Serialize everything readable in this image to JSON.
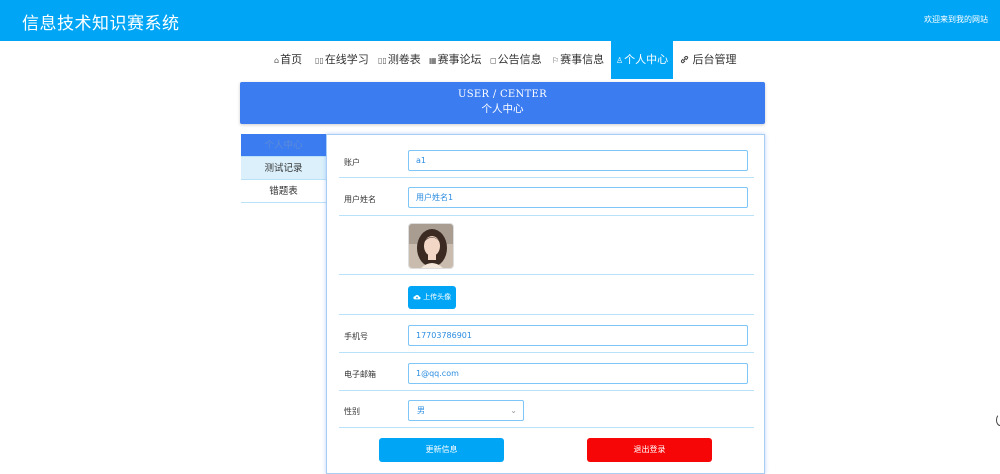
{
  "header": {
    "title": "信息技术知识赛系统",
    "welcome": "欢迎来到我的网站"
  },
  "nav": {
    "items": [
      {
        "icon": "⌂",
        "icon_name": "home-icon",
        "label": "首页"
      },
      {
        "icon": "▯▯",
        "icon_name": "book-icon",
        "label": "在线学习"
      },
      {
        "icon": "▯▯",
        "icon_name": "test-icon",
        "label": "测卷表"
      },
      {
        "icon": "▦",
        "icon_name": "forum-icon",
        "label": "赛事论坛"
      },
      {
        "icon": "◻",
        "icon_name": "notice-icon",
        "label": "公告信息"
      },
      {
        "icon": "⚐",
        "icon_name": "flag-icon",
        "label": "赛事信息"
      },
      {
        "icon": "♙",
        "icon_name": "user-icon",
        "label": "个人中心"
      },
      {
        "icon": "🔗",
        "icon_name": "link-icon",
        "label": "后台管理"
      }
    ],
    "active_index": 6
  },
  "banner": {
    "en": "USER / CENTER",
    "cn": "个人中心"
  },
  "sidebar": {
    "items": [
      {
        "label": "个人中心"
      },
      {
        "label": "测试记录"
      },
      {
        "label": "错题表"
      }
    ]
  },
  "form": {
    "account_label": "账户",
    "account_value": "a1",
    "name_label": "用户姓名",
    "name_value": "用户姓名1",
    "upload_label": "上传头像",
    "phone_label": "手机号",
    "phone_value": "17703786901",
    "email_label": "电子邮箱",
    "email_value": "1@qq.com",
    "gender_label": "性别",
    "gender_value": "男",
    "update_button": "更新信息",
    "logout_button": "退出登录"
  },
  "colors": {
    "brand": "#00a6f5",
    "banner": "#3b7cf0",
    "danger": "#f60606"
  }
}
